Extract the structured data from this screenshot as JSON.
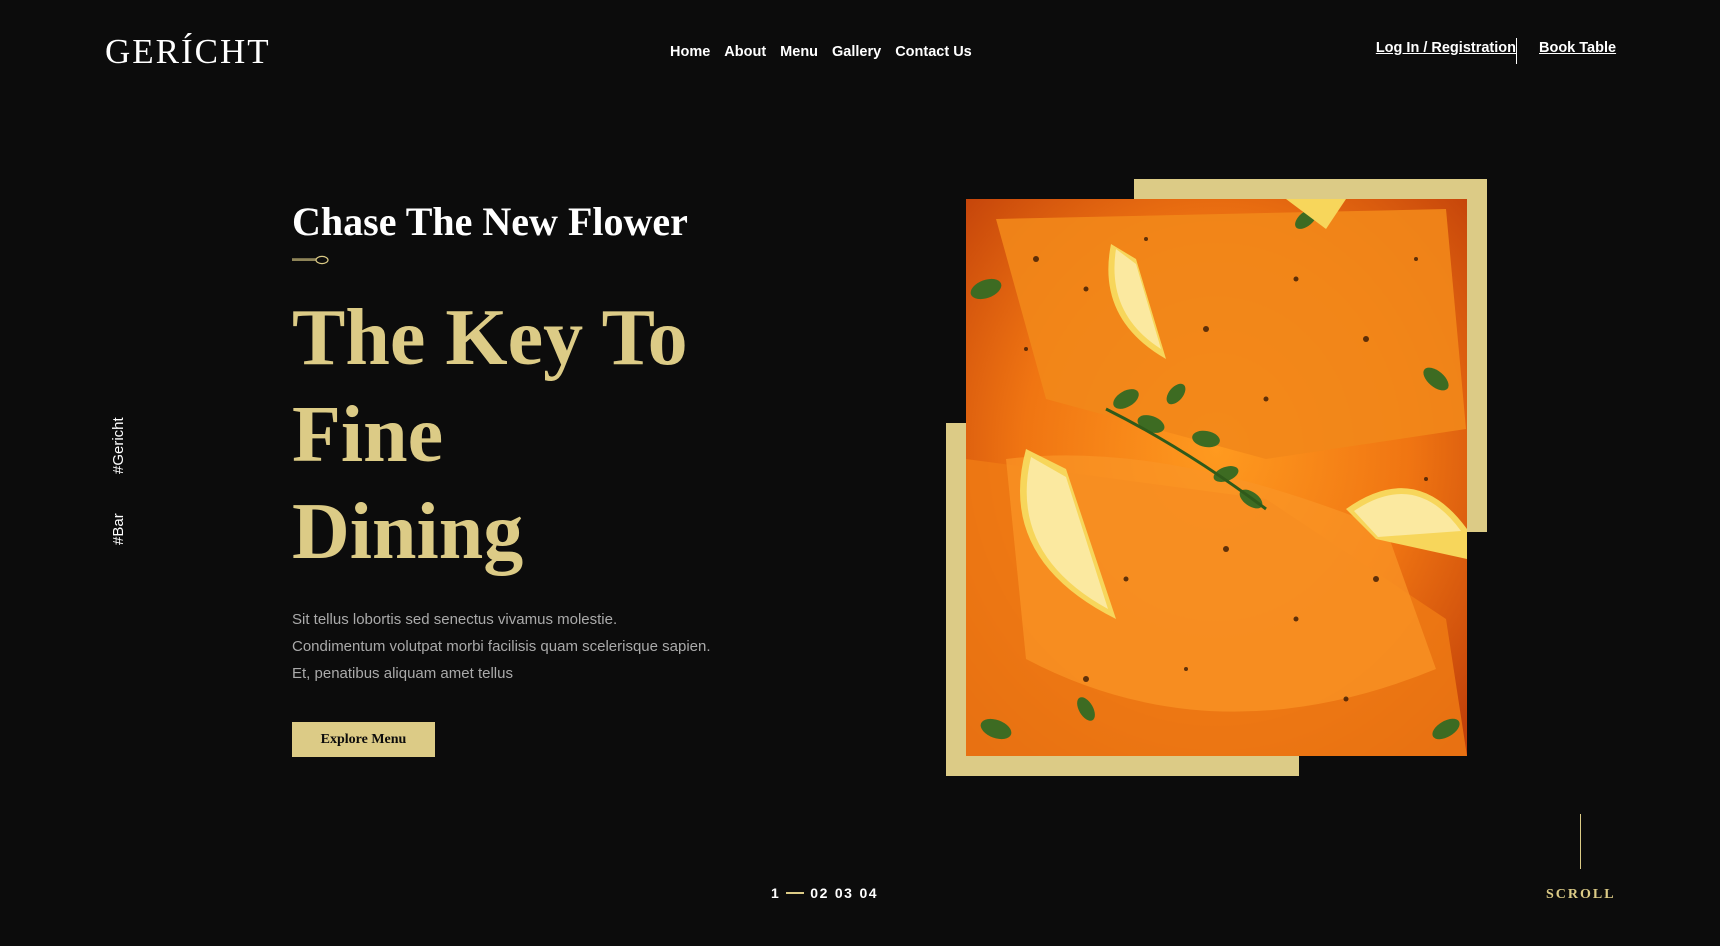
{
  "brand": {
    "logo": "GERÍCHT"
  },
  "nav": {
    "links": [
      "Home",
      "About",
      "Menu",
      "Gallery",
      "Contact Us"
    ],
    "login": "Log In / Registration",
    "book": "Book Table"
  },
  "side_tags": [
    "#Gericht",
    "#Bar"
  ],
  "hero": {
    "subtitle": "Chase The New Flower",
    "headline": [
      "The Key To",
      "Fine",
      "Dining"
    ],
    "description": [
      "Sit tellus lobortis sed senectus vivamus molestie.",
      "Condimentum volutpat morbi facilisis quam scelerisque sapien.",
      "Et, penatibus aliquam amet tellus"
    ],
    "cta": "Explore Menu"
  },
  "pagination": {
    "current": "1",
    "others": [
      "02",
      "03",
      "04"
    ]
  },
  "scroll": "SCROLL",
  "colors": {
    "accent": "#dccb86",
    "background": "#0c0c0c",
    "muted_text": "#aaaaaa"
  },
  "images": {
    "hero": "salmon-with-lemon-and-herbs"
  }
}
